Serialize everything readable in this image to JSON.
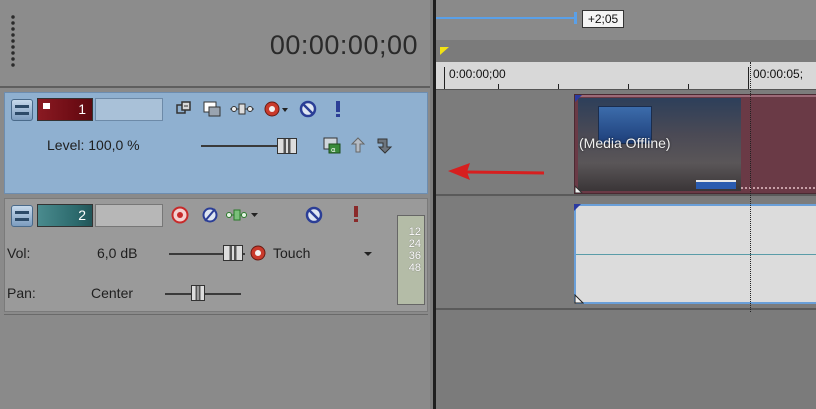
{
  "header": {
    "timecode": "00:00:00;00"
  },
  "track1": {
    "number": "1",
    "level_label": "Level: 100,0 %",
    "icons": [
      "bypass-fx-icon",
      "compositing-mode-icon",
      "fx-chain-icon",
      "gear-icon",
      "mute-icon",
      "solo-icon",
      "motion-blur-icon",
      "composite-parent-icon",
      "composite-child-icon"
    ]
  },
  "track2": {
    "number": "2",
    "vol_label": "Vol:",
    "vol_value": "6,0 dB",
    "automation_mode": "Touch",
    "pan_label": "Pan:",
    "pan_value": "Center",
    "meter_ticks": [
      "12",
      "24",
      "36",
      "48"
    ],
    "icons": [
      "record-arm-icon",
      "invert-phase-icon",
      "fx-chain-icon",
      "mute-icon",
      "solo-icon",
      "gear-icon"
    ]
  },
  "timeline": {
    "loop_duration": "+2;05",
    "ruler_labels": [
      "0:00:00;00",
      "00:00:05;"
    ],
    "video_clip_label": "(Media Offline)"
  },
  "colors": {
    "track1_bg": "#8fb0d0",
    "video_clip": "#6a3a46",
    "audio_clip_border": "#6a9fd8",
    "arrow": "#d61f1f"
  }
}
